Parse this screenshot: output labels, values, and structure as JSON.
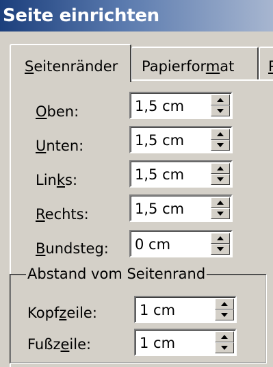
{
  "window": {
    "title": "Seite einrichten"
  },
  "tabs": [
    {
      "pre": "",
      "mn": "S",
      "post": "eitenränder"
    },
    {
      "pre": "Papierfor",
      "mn": "m",
      "post": "at"
    },
    {
      "pre": "",
      "mn": "P",
      "post": "a"
    }
  ],
  "margins": {
    "top": {
      "pre": "",
      "mn": "O",
      "post": "ben:",
      "value": "1,5 cm"
    },
    "bottom": {
      "pre": "",
      "mn": "U",
      "post": "nten:",
      "value": "1,5 cm"
    },
    "left": {
      "pre": "Lin",
      "mn": "k",
      "post": "s:",
      "value": "1,5 cm"
    },
    "right": {
      "pre": "",
      "mn": "R",
      "post": "echts:",
      "value": "1,5 cm"
    },
    "gutter": {
      "pre": "",
      "mn": "B",
      "post": "undsteg:",
      "value": "0 cm"
    }
  },
  "header_footer_group": {
    "legend": "Abstand vom Seitenrand",
    "header": {
      "pre": "Kopf",
      "mn": "z",
      "post": "eile:",
      "value": "1 cm"
    },
    "footer": {
      "pre": "Fußz",
      "mn": "e",
      "post": "ile:",
      "value": "1 cm"
    }
  },
  "icons": {
    "spin_up": "triangle-up-icon",
    "spin_down": "triangle-down-icon"
  }
}
